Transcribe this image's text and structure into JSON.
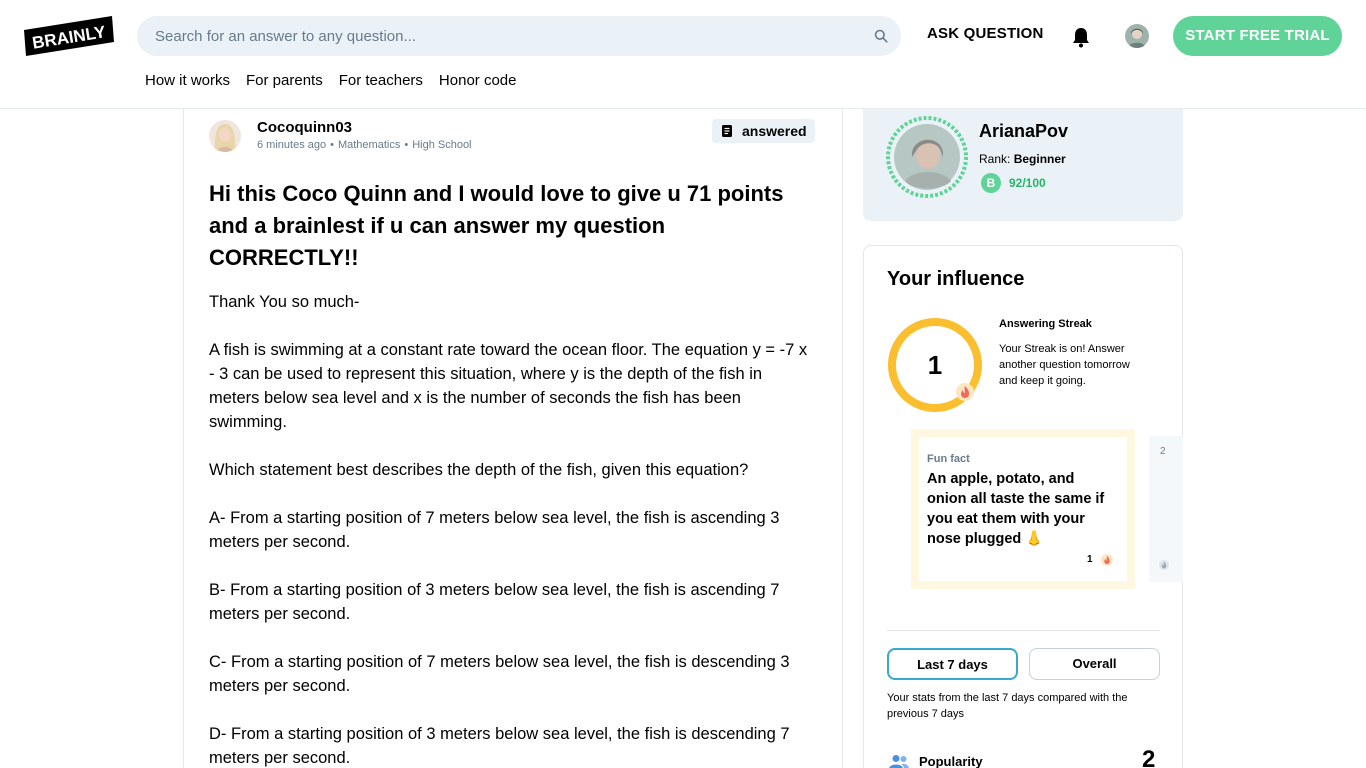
{
  "header": {
    "search_placeholder": "Search for an answer to any question...",
    "ask_label": "ASK QUESTION",
    "trial_label": "START FREE TRIAL",
    "nav": [
      "How it works",
      "For parents",
      "For teachers",
      "Honor code"
    ],
    "logo_text": "BRAINLY"
  },
  "question": {
    "author": "Cocoquinn03",
    "time": "6 minutes ago",
    "subject": "Mathematics",
    "level": "High School",
    "status": "answered",
    "title": "Hi this Coco Quinn and I would love to give u 71 points and a brainlest if u can answer my question CORRECTLY!!",
    "paragraphs": [
      "Thank You so much-",
      "A fish is swimming at a constant rate toward the ocean floor. The equation y = -7 x - 3 can be used to represent this situation, where y is the depth of the fish in meters below sea level and x is the number of seconds the fish has been swimming.",
      "Which statement best describes the depth of the fish, given this equation?",
      "A- From a starting position of 7 meters below sea level, the fish is ascending 3 meters per second.",
      "B- From a starting position of 3 meters below sea level, the fish is ascending 7 meters per second.",
      "C- From a starting position of 7 meters below sea level, the fish is descending 3 meters per second.",
      "D- From a starting position of 3 meters below sea level, the fish is descending 7 meters per second."
    ]
  },
  "profile": {
    "name": "ArianaPov",
    "rank_label": "Rank:",
    "rank": "Beginner",
    "points": "92/100",
    "points_icon_letter": "B"
  },
  "influence": {
    "title": "Your influence",
    "streak_value": "1",
    "streak_heading": "Answering Streak",
    "streak_text": "Your Streak is on! Answer another question tomorrow and keep it going.",
    "fun_fact_label": "Fun fact",
    "fun_fact_text": "An apple, potato, and onion all taste the same if you eat them with your nose plugged 👃",
    "fun_fact_count": "1",
    "next_card_number": "2",
    "tab_recent": "Last 7 days",
    "tab_overall": "Overall",
    "note": "Your stats from the last 7 days compared with the previous 7 days",
    "popularity_label": "Popularity",
    "popularity_value": "2"
  },
  "colors": {
    "brand_green": "#60d399",
    "streak_yellow": "#fbbe2e",
    "tab_active_border": "#3aa8c8",
    "panel_bg": "#ebf2f7"
  }
}
